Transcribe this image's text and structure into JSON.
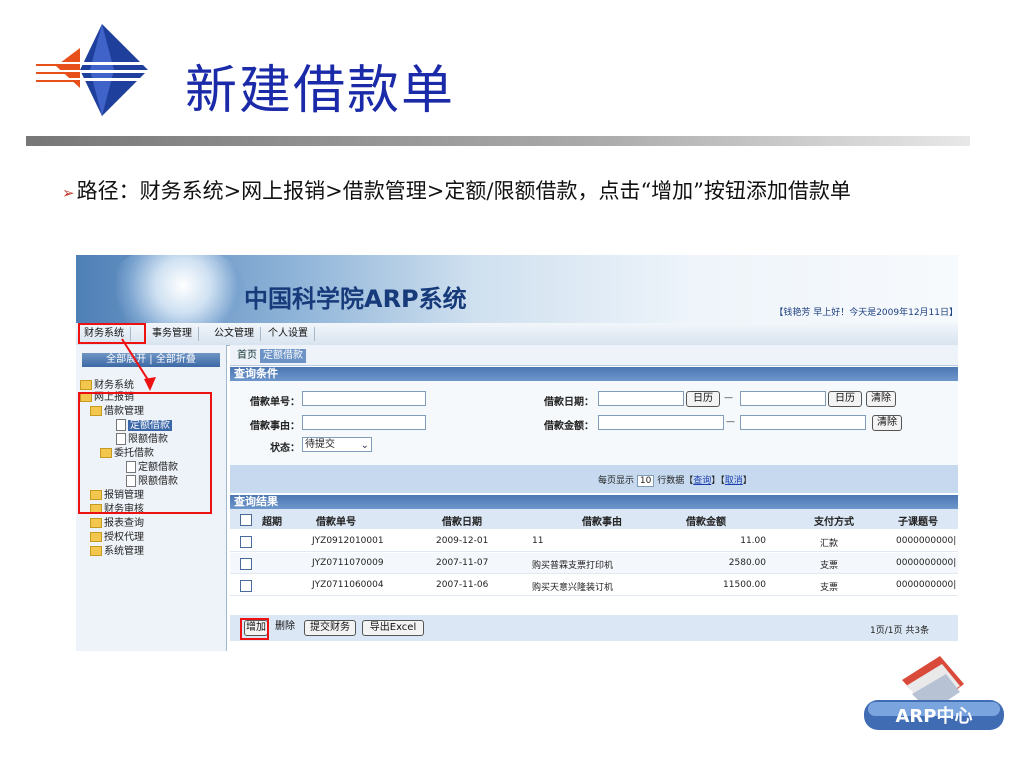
{
  "slide": {
    "title": "新建借款单",
    "bullet": "➢",
    "path_text": "路径：财务系统>网上报销>借款管理>定额/限额借款，点击“增加”按钮添加借款单"
  },
  "system": {
    "title": "中国科学院ARP系统",
    "greeting": "【钱艳芳 早上好！今天是2009年12月11日】"
  },
  "menu": [
    "财务系统",
    "事务管理",
    "公文管理",
    "个人设置"
  ],
  "sidebar": {
    "expand_label": "全部展开 | 全部折叠",
    "tree": [
      {
        "label": "财务系统",
        "icon": "module-icon"
      },
      {
        "label": "网上报销",
        "icon": "folder-icon"
      },
      {
        "label": "借款管理",
        "icon": "folder-icon"
      },
      {
        "label": "定额借款",
        "icon": "page-icon",
        "selected": true
      },
      {
        "label": "限额借款",
        "icon": "page-icon"
      },
      {
        "label": "委托借款",
        "icon": "folder-icon"
      },
      {
        "label": "定额借款",
        "icon": "page-icon"
      },
      {
        "label": "限额借款",
        "icon": "page-icon"
      },
      {
        "label": "报销管理",
        "icon": "folder-icon"
      },
      {
        "label": "财务审核",
        "icon": "folder-icon"
      },
      {
        "label": "报表查询",
        "icon": "folder-icon"
      },
      {
        "label": "授权代理",
        "icon": "folder-icon"
      },
      {
        "label": "系统管理",
        "icon": "folder-icon"
      }
    ]
  },
  "tabs": [
    "首页",
    "定额借款"
  ],
  "query": {
    "title": "查询条件",
    "loan_no_label": "借款单号：",
    "reason_label": "借款事由：",
    "status_label": "状态：",
    "status_value": "待提交",
    "date_label": "借款日期：",
    "amount_label": "借款金额：",
    "calendar_label": "日历",
    "dash": "—",
    "clear_label": "清除"
  },
  "pager": {
    "prefix": "每页显示",
    "page_size": "10",
    "suffix": "行数据",
    "query_link": "查询",
    "cancel_link": "取消"
  },
  "results": {
    "title": "查询结果",
    "columns": [
      "超期",
      "借款单号",
      "借款日期",
      "借款事由",
      "借款金额",
      "支付方式",
      "子课题号"
    ],
    "rows": [
      {
        "overdue": "",
        "no": "JYZ0912010001",
        "date": "2009-12-01",
        "reason": "11",
        "amount": "11.00",
        "pay": "汇款",
        "sub": "0000000000|"
      },
      {
        "overdue": "",
        "no": "JYZ0711070009",
        "date": "2007-11-07",
        "reason": "购买普霖支票打印机",
        "amount": "2580.00",
        "pay": "支票",
        "sub": "0000000000|"
      },
      {
        "overdue": "",
        "no": "JYZ0711060004",
        "date": "2007-11-06",
        "reason": "购买天意兴隆装订机",
        "amount": "11500.00",
        "pay": "支票",
        "sub": "0000000000|"
      }
    ]
  },
  "footer": {
    "add_label": "增加",
    "delete_label": "删除",
    "submit_label": "提交财务",
    "export_label": "导出Excel",
    "page_info": "1页/1页 共3条"
  },
  "badge": {
    "text": "ARP中心"
  },
  "colors": {
    "title_blue": "#1a2aa8",
    "highlight_red": "#e11111",
    "header_blue": "#4c76b1"
  }
}
